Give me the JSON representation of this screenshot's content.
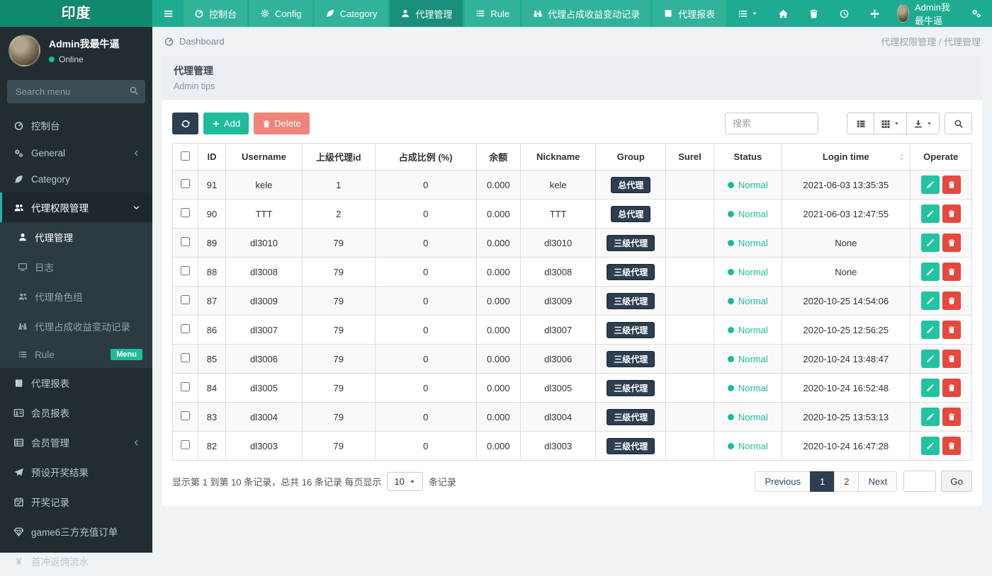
{
  "brand": "印度",
  "colors": {
    "accent_teal": "#18bc9c",
    "navbar_teal": "#1dac91",
    "brand_teal_dark": "#0f8a6e",
    "sidebar_dark": "#222d32",
    "navy": "#2c3e50",
    "danger_red": "#e6483d",
    "delete_salmon": "#ef857a",
    "status_green": "#1dbc9c"
  },
  "navbar": {
    "menu": [
      {
        "label": "控制台",
        "icon": "gauge-icon",
        "active": false
      },
      {
        "label": "Config",
        "icon": "gear-icon",
        "active": false
      },
      {
        "label": "Category",
        "icon": "leaf-icon",
        "active": false
      },
      {
        "label": "代理管理",
        "icon": "user-icon",
        "active": true
      },
      {
        "label": "Rule",
        "icon": "list-icon",
        "active": false
      },
      {
        "label": "代理占成收益变动记录",
        "icon": "binoculars-icon",
        "active": false
      },
      {
        "label": "代理报表",
        "icon": "book-icon",
        "active": false
      }
    ],
    "username": "Admin我最牛逼"
  },
  "sidebar": {
    "user_name": "Admin我最牛逼",
    "user_status": "Online",
    "search_placeholder": "Search menu",
    "menu": [
      {
        "label": "控制台",
        "icon": "gauge-icon"
      },
      {
        "label": "General",
        "icon": "gears-icon",
        "arrow": "left"
      },
      {
        "label": "Category",
        "icon": "leaf-icon"
      },
      {
        "label": "代理权限管理",
        "icon": "users-icon",
        "arrow": "down",
        "active": true,
        "children": [
          {
            "label": "代理管理",
            "icon": "user-icon",
            "active": true
          },
          {
            "label": "日志",
            "icon": "tv-icon"
          },
          {
            "label": "代理角色组",
            "icon": "users-icon"
          },
          {
            "label": "代理占成收益变动记录",
            "icon": "binoculars-icon"
          },
          {
            "label": "Rule",
            "icon": "list-icon",
            "badge": "Menu"
          }
        ]
      },
      {
        "label": "代理报表",
        "icon": "book-icon"
      },
      {
        "label": "会员报表",
        "icon": "vcard-icon"
      },
      {
        "label": "会员管理",
        "icon": "table-icon",
        "arrow": "left"
      },
      {
        "label": "预设开奖结果",
        "icon": "send-icon"
      },
      {
        "label": "开奖记录",
        "icon": "calendar-icon"
      },
      {
        "label": "game6三方充值订单",
        "icon": "gem-icon"
      },
      {
        "label": "首冲返佣流水",
        "icon": "yen-icon"
      }
    ]
  },
  "breadcrumb": {
    "dashboard_label": "Dashboard",
    "crumbs": [
      "代理权限管理",
      "代理管理"
    ],
    "separator": " / "
  },
  "panel": {
    "title": "代理管理",
    "subtitle": "Admin tips"
  },
  "toolbar": {
    "add_label": "Add",
    "delete_label": "Delete",
    "search_placeholder": "搜索"
  },
  "table": {
    "columns": [
      "ID",
      "Username",
      "上级代理id",
      "占成比例 (%)",
      "余额",
      "Nickname",
      "Group",
      "Surel",
      "Status",
      "Login time",
      "Operate"
    ],
    "rows": [
      {
        "id": "91",
        "username": "kele",
        "parent_id": "1",
        "ratio": "0",
        "balance": "0.000",
        "nickname": "kele",
        "group": "总代理",
        "surel": "",
        "status": "Normal",
        "login_time": "2021-06-03 13:35:35"
      },
      {
        "id": "90",
        "username": "TTT",
        "parent_id": "2",
        "ratio": "0",
        "balance": "0.000",
        "nickname": "TTT",
        "group": "总代理",
        "surel": "",
        "status": "Normal",
        "login_time": "2021-06-03 12:47:55"
      },
      {
        "id": "89",
        "username": "dl3010",
        "parent_id": "79",
        "ratio": "0",
        "balance": "0.000",
        "nickname": "dl3010",
        "group": "三级代理",
        "surel": "",
        "status": "Normal",
        "login_time": "None"
      },
      {
        "id": "88",
        "username": "dl3008",
        "parent_id": "79",
        "ratio": "0",
        "balance": "0.000",
        "nickname": "dl3008",
        "group": "三级代理",
        "surel": "",
        "status": "Normal",
        "login_time": "None"
      },
      {
        "id": "87",
        "username": "dl3009",
        "parent_id": "79",
        "ratio": "0",
        "balance": "0.000",
        "nickname": "dl3009",
        "group": "三级代理",
        "surel": "",
        "status": "Normal",
        "login_time": "2020-10-25 14:54:06"
      },
      {
        "id": "86",
        "username": "dl3007",
        "parent_id": "79",
        "ratio": "0",
        "balance": "0.000",
        "nickname": "dl3007",
        "group": "三级代理",
        "surel": "",
        "status": "Normal",
        "login_time": "2020-10-25 12:56:25"
      },
      {
        "id": "85",
        "username": "dl3006",
        "parent_id": "79",
        "ratio": "0",
        "balance": "0.000",
        "nickname": "dl3006",
        "group": "三级代理",
        "surel": "",
        "status": "Normal",
        "login_time": "2020-10-24 13:48:47"
      },
      {
        "id": "84",
        "username": "dl3005",
        "parent_id": "79",
        "ratio": "0",
        "balance": "0.000",
        "nickname": "dl3005",
        "group": "三级代理",
        "surel": "",
        "status": "Normal",
        "login_time": "2020-10-24 16:52:48"
      },
      {
        "id": "83",
        "username": "dl3004",
        "parent_id": "79",
        "ratio": "0",
        "balance": "0.000",
        "nickname": "dl3004",
        "group": "三级代理",
        "surel": "",
        "status": "Normal",
        "login_time": "2020-10-25 13:53:13"
      },
      {
        "id": "82",
        "username": "dl3003",
        "parent_id": "79",
        "ratio": "0",
        "balance": "0.000",
        "nickname": "dl3003",
        "group": "三级代理",
        "surel": "",
        "status": "Normal",
        "login_time": "2020-10-24 16:47:28"
      }
    ]
  },
  "pagination": {
    "info_prefix": "显示第 1 到第 10 条记录，总共 16 条记录 每页显示",
    "page_size": "10",
    "info_suffix": "条记录",
    "pages": [
      "Previous",
      "1",
      "2",
      "Next"
    ],
    "active_page": "1",
    "go_label": "Go"
  }
}
